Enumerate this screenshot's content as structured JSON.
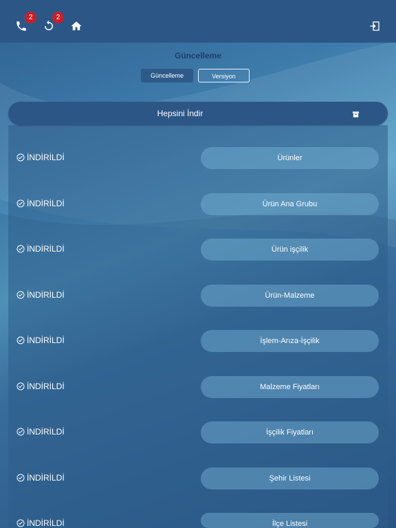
{
  "header": {
    "phone_badge": "2",
    "sync_badge": "2"
  },
  "page": {
    "title": "Güncelleme",
    "segments": [
      "Güncelleme",
      "Versiyon"
    ],
    "download_all_label": "Hepsini İndir"
  },
  "items": [
    {
      "status": "İNDİRİLDİ",
      "label": "Ürünler"
    },
    {
      "status": "İNDİRİLDİ",
      "label": "Ürün Ana Grubu"
    },
    {
      "status": "İNDİRİLDİ",
      "label": "Ürün işçilik"
    },
    {
      "status": "İNDİRİLDİ",
      "label": "Ürün-Malzeme"
    },
    {
      "status": "İNDİRİLDİ",
      "label": "İşlem-Arıza-İşçilik"
    },
    {
      "status": "İNDİRİLDİ",
      "label": "Malzeme Fiyatları"
    },
    {
      "status": "İNDİRİLDİ",
      "label": "İşçilik Fiyatları"
    },
    {
      "status": "İNDİRİLDİ",
      "label": "Şehir Listesi"
    },
    {
      "status": "İNDİRİLDİ",
      "label": "İlçe Listesi"
    }
  ],
  "colors": {
    "header_bg": "#2c5686",
    "badge": "#c8202b",
    "title": "#1f3f66"
  }
}
